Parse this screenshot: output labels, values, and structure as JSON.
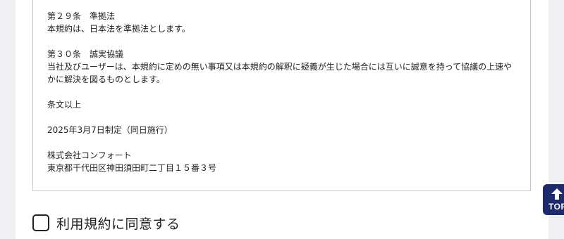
{
  "terms": {
    "article29_title": "第２９条　準拠法",
    "article29_body": "本規約は、日本法を準拠法とします。",
    "article30_title": "第３０条　誠実協議",
    "article30_body": "当社及びユーザーは、本規約に定めの無い事項又は本規約の解釈に疑義が生じた場合には互いに誠意を持って協議の上速やかに解決を図るものとします。",
    "closing": "条文以上",
    "enacted": "2025年3月7日制定（同日施行）",
    "company_name": "株式会社コンフォート",
    "company_address": "東京都千代田区神田須田町二丁目１５番３号"
  },
  "agreement": {
    "label": "利用規約に同意する",
    "checked": false
  },
  "top_button": {
    "label": "TOP",
    "icon": "arrow-up-icon"
  }
}
